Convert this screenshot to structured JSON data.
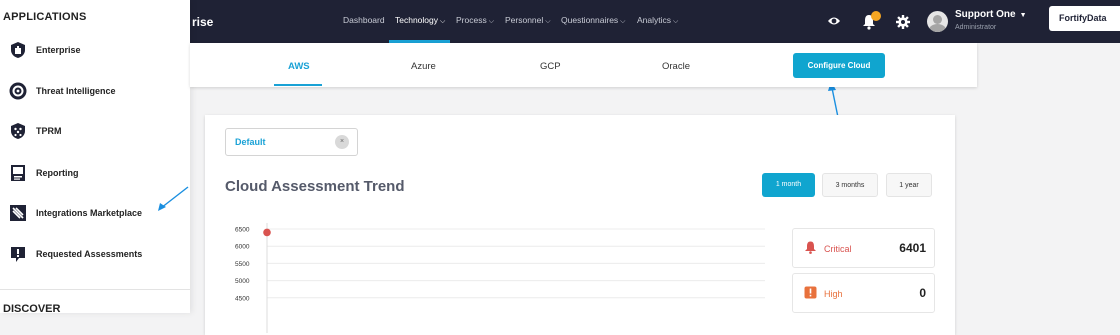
{
  "header": {
    "brand_fragment": "rise",
    "nav": [
      {
        "label": "Dashboard",
        "has_menu": false
      },
      {
        "label": "Technology",
        "has_menu": true
      },
      {
        "label": "Process",
        "has_menu": true
      },
      {
        "label": "Personnel",
        "has_menu": true
      },
      {
        "label": "Questionnaires",
        "has_menu": true
      },
      {
        "label": "Analytics",
        "has_menu": true
      }
    ],
    "active_nav": "Technology",
    "user_name": "Support One",
    "user_role": "Administrator",
    "org_name": "FortifyData",
    "icons": [
      "eye-icon",
      "bell-icon",
      "gear-icon",
      "avatar"
    ],
    "colors": {
      "bar": "#1f2235",
      "accent": "#1aa2d6",
      "badge": "#f5a623"
    }
  },
  "sidebar": {
    "title": "APPLICATIONS",
    "items": [
      {
        "label": "Enterprise",
        "icon": "enterprise-icon"
      },
      {
        "label": "Threat Intelligence",
        "icon": "threat-intelligence-icon"
      },
      {
        "label": "TPRM",
        "icon": "tprm-icon"
      },
      {
        "label": "Reporting",
        "icon": "reporting-icon"
      },
      {
        "label": "Integrations Marketplace",
        "icon": "integrations-icon"
      },
      {
        "label": "Requested Assessments",
        "icon": "exclamation-icon"
      }
    ],
    "next_section": "DISCOVER"
  },
  "cloud_tabs": {
    "tabs": [
      "AWS",
      "Azure",
      "GCP",
      "Oracle"
    ],
    "active": "AWS",
    "configure_label": "Configure Cloud"
  },
  "main": {
    "select_value": "Default",
    "select_clear": "×",
    "title": "Cloud Assessment Trend",
    "ranges": [
      "1 month",
      "3 months",
      "1 year"
    ],
    "active_range": "1 month",
    "stats": [
      {
        "label": "Critical",
        "value": "6401",
        "color": "#d9534f",
        "icon": "critical-bell-icon"
      },
      {
        "label": "High",
        "value": "0",
        "color": "#e8713c",
        "icon": "high-alert-icon"
      }
    ]
  },
  "chart_data": {
    "type": "line",
    "y_ticks": [
      "6500",
      "6000",
      "5500",
      "5000",
      "4500"
    ],
    "series": [
      {
        "values": [
          6401
        ],
        "color": "#d9534f"
      }
    ]
  }
}
